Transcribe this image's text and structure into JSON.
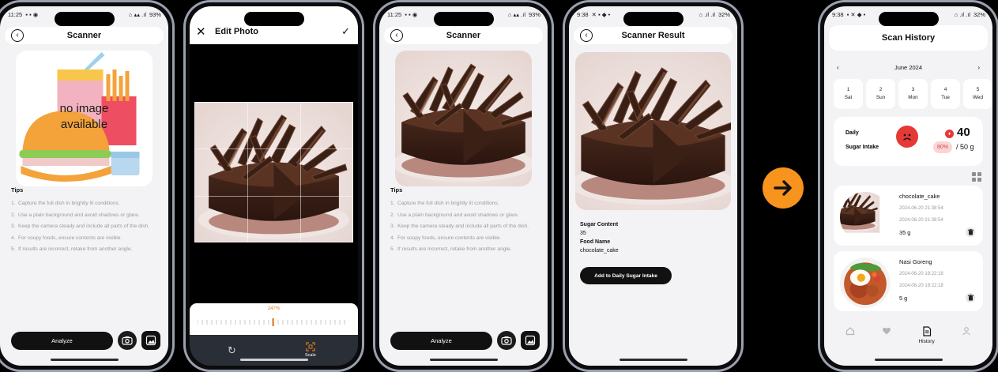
{
  "colors": {
    "accent": "#f7941d",
    "danger": "#e53935",
    "dark": "#111111"
  },
  "screen1": {
    "status_time": "11:25",
    "status_battery": "93%",
    "title": "Scanner",
    "placeholder_line1": "no image",
    "placeholder_line2": "available",
    "tips_title": "Tips",
    "tips": [
      {
        "n": "1.",
        "text": "Capture the full dish in brightly lit conditions."
      },
      {
        "n": "2.",
        "text": "Use a plain background and avoid shadows or glare."
      },
      {
        "n": "3.",
        "text": "Keep the camera steady and include all parts of the dish."
      },
      {
        "n": "4.",
        "text": "For soupy foods, ensure contents are visible."
      },
      {
        "n": "5.",
        "text": "If results are incorrect, retake from another angle."
      }
    ],
    "analyze_label": "Analyze"
  },
  "screen2": {
    "title": "Edit Photo",
    "scale_value": "247%",
    "scale_label": "Scale"
  },
  "screen3": {
    "status_time": "11:25",
    "status_battery": "93%",
    "title": "Scanner",
    "tips_title": "Tips",
    "tips": [
      {
        "n": "1.",
        "text": "Capture the full dish in brightly lit conditions."
      },
      {
        "n": "2.",
        "text": "Use a plain background and avoid shadows or glare."
      },
      {
        "n": "3.",
        "text": "Keep the camera steady and include all parts of the dish."
      },
      {
        "n": "4.",
        "text": "For soupy foods, ensure contents are visible."
      },
      {
        "n": "5.",
        "text": "If results are incorrect, retake from another angle."
      }
    ],
    "analyze_label": "Analyze"
  },
  "screen4": {
    "status_time": "9:38",
    "status_battery": "32%",
    "title": "Scanner Result",
    "sugar_label": "Sugar Content",
    "sugar_value": "35",
    "food_label": "Food Name",
    "food_value": "chocolate_cake",
    "add_button": "Add to Daily Sugar Intake"
  },
  "screen5": {
    "status_time": "9:38",
    "status_battery": "32%",
    "title": "Scan History",
    "month": "June 2024",
    "days": [
      {
        "num": "1",
        "dow": "Sat"
      },
      {
        "num": "2",
        "dow": "Sun"
      },
      {
        "num": "3",
        "dow": "Mon"
      },
      {
        "num": "4",
        "dow": "Tue"
      },
      {
        "num": "5",
        "dow": "Wed"
      }
    ],
    "daily_label": "Daily",
    "intake_label": "Sugar Intake",
    "intake_value": "40",
    "intake_percent": "80%",
    "intake_limit": "/ 50 g",
    "history": [
      {
        "name": "chocolate_cake",
        "time1": "2024-06-20 21:38:54",
        "time2": "2024-06-20 21:38:54",
        "amount": "35 g"
      },
      {
        "name": "Nasi Goreng",
        "time1": "2024-06-20 19:22:18",
        "time2": "2024-06-20 19:22:18",
        "amount": "5 g"
      }
    ],
    "nav_history": "History"
  }
}
